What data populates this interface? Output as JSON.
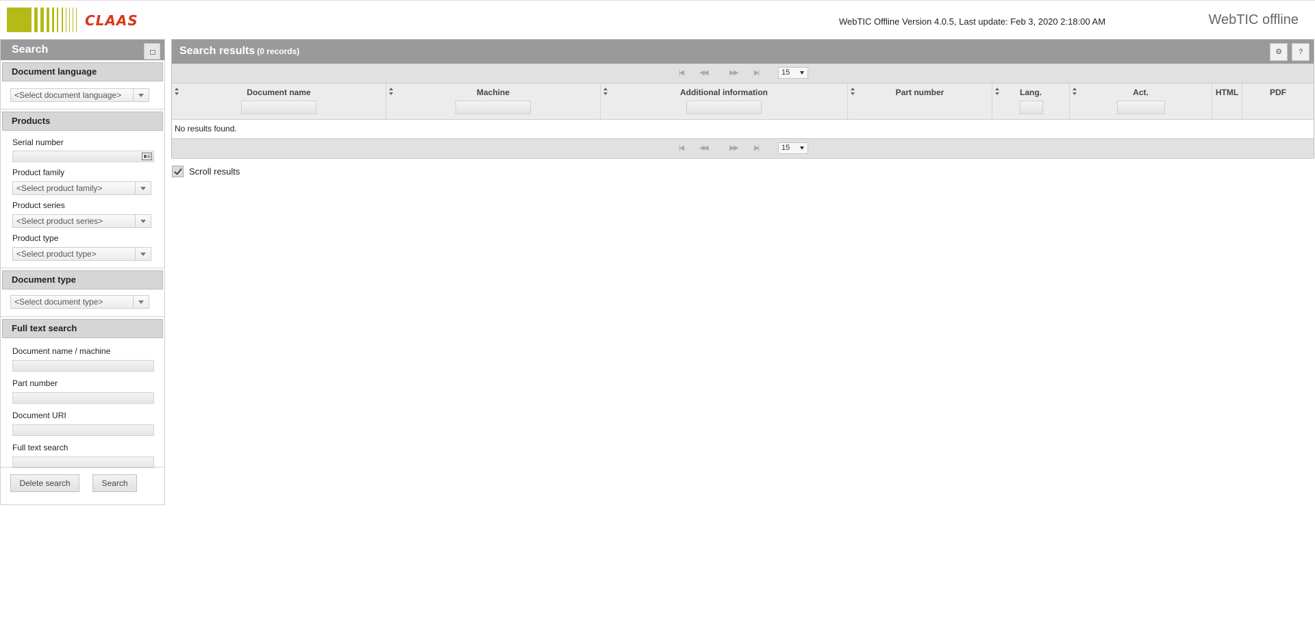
{
  "header": {
    "logo_text": "CLAAS",
    "version_text": "WebTIC Offline Version 4.0.5, Last update: Feb 3, 2020 2:18:00 AM",
    "brand": "WebTIC offline"
  },
  "sidebar": {
    "title": "Search",
    "document_language": {
      "heading": "Document language",
      "placeholder": "<Select document language>"
    },
    "products": {
      "heading": "Products",
      "serial_label": "Serial number",
      "family_label": "Product family",
      "family_placeholder": "<Select product family>",
      "series_label": "Product series",
      "series_placeholder": "<Select product series>",
      "type_label": "Product type",
      "type_placeholder": "<Select product type>"
    },
    "document_type": {
      "heading": "Document type",
      "placeholder": "<Select document type>"
    },
    "full_text": {
      "heading": "Full text search",
      "doc_name_label": "Document name / machine",
      "part_number_label": "Part number",
      "doc_uri_label": "Document URI",
      "full_text_label": "Full text search"
    },
    "buttons": {
      "delete": "Delete search",
      "search": "Search"
    }
  },
  "results": {
    "title": "Search results",
    "count": "(0 records)",
    "settings_icon": "gear-icon",
    "help_label": "?",
    "page_size": "15",
    "columns": [
      "Document name",
      "Machine",
      "Additional information",
      "Part number",
      "Lang.",
      "Act.",
      "HTML",
      "PDF"
    ],
    "empty_message": "No results found.",
    "scroll_label": "Scroll results"
  },
  "colors": {
    "brand_green": "#b5ba18",
    "brand_red": "#d9361a",
    "panel_header": "#9a9a9a"
  }
}
